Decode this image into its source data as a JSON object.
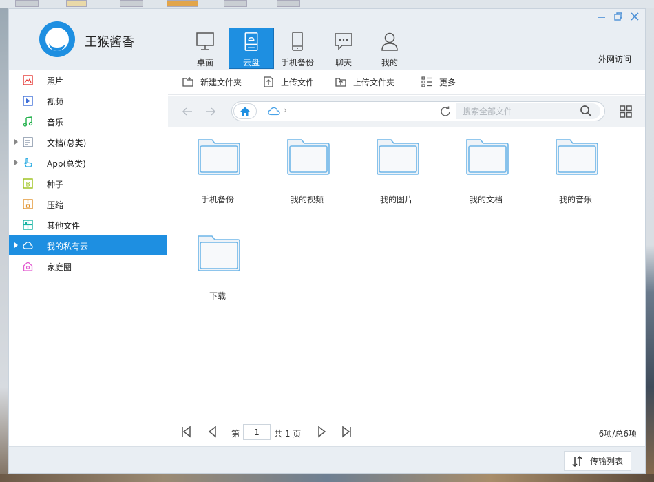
{
  "app": {
    "name": "王猴酱香"
  },
  "nav": {
    "items": [
      {
        "label": "桌面",
        "icon": "monitor-icon"
      },
      {
        "label": "云盘",
        "icon": "cloud-drive-icon"
      },
      {
        "label": "手机备份",
        "icon": "phone-icon"
      },
      {
        "label": "聊天",
        "icon": "chat-icon"
      },
      {
        "label": "我的",
        "icon": "user-icon"
      }
    ],
    "active_index": 1
  },
  "header": {
    "external_access": "外网访问"
  },
  "sidebar": {
    "items": [
      {
        "label": "照片",
        "icon": "photo-icon",
        "color": "#e53935"
      },
      {
        "label": "视频",
        "icon": "video-icon",
        "color": "#3f6fd8"
      },
      {
        "label": "音乐",
        "icon": "music-icon",
        "color": "#22b04b"
      },
      {
        "label": "文档(总类)",
        "icon": "document-icon",
        "color": "#7a8aa0",
        "expandable": true
      },
      {
        "label": "App(总类)",
        "icon": "app-hand-icon",
        "color": "#1ea7e1",
        "expandable": true
      },
      {
        "label": "种子",
        "icon": "torrent-icon",
        "color": "#9bc017"
      },
      {
        "label": "压缩",
        "icon": "archive-icon",
        "color": "#e0912b"
      },
      {
        "label": "其他文件",
        "icon": "other-files-icon",
        "color": "#17b3a3"
      },
      {
        "label": "我的私有云",
        "icon": "private-cloud-icon",
        "color": "#ffffff",
        "expandable": true
      },
      {
        "label": "家庭圈",
        "icon": "home-circle-icon",
        "color": "#e25bd0"
      }
    ],
    "active_index": 8
  },
  "toolbar": {
    "new_folder": "新建文件夹",
    "upload_file": "上传文件",
    "upload_folder": "上传文件夹",
    "more": "更多"
  },
  "address": {
    "search_placeholder": "搜索全部文件",
    "separator": "›"
  },
  "files": [
    {
      "name": "手机备份"
    },
    {
      "name": "我的视频"
    },
    {
      "name": "我的图片"
    },
    {
      "name": "我的文档"
    },
    {
      "name": "我的音乐"
    },
    {
      "name": "下载"
    }
  ],
  "pager": {
    "page_prefix": "第",
    "current_page": "1",
    "total_text": "共 1 页",
    "count_text": "6项/总6项"
  },
  "status": {
    "transfer_list": "传输列表"
  },
  "colors": {
    "accent": "#1e8fe1",
    "folder_stroke": "#6fb6e8",
    "folder_fill": "#f4f7fa"
  }
}
